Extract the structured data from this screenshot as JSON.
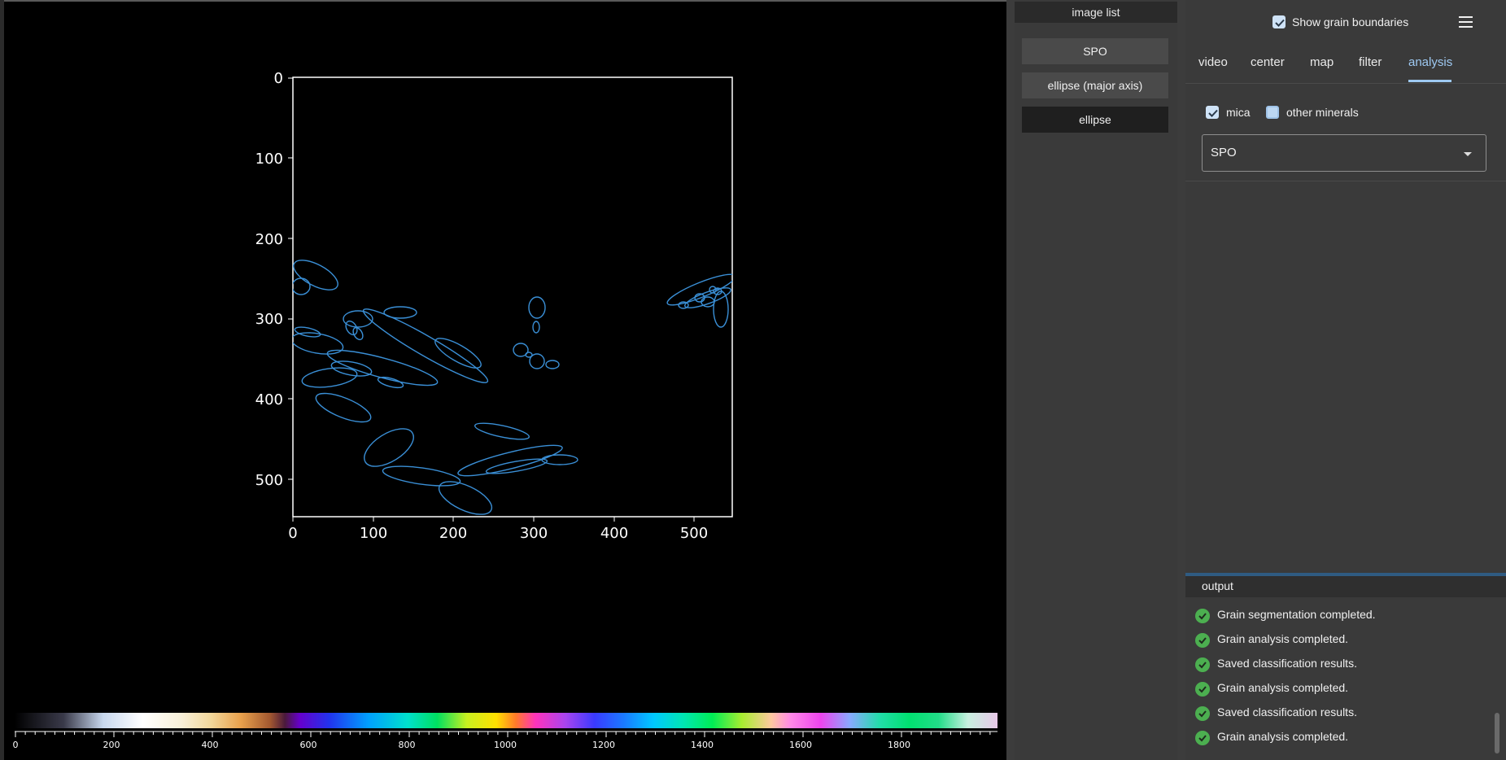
{
  "viewer": {
    "plot": {
      "xticks": [
        "0",
        "100",
        "200",
        "300",
        "400",
        "500"
      ],
      "yticks": [
        "0",
        "100",
        "200",
        "300",
        "400",
        "500"
      ],
      "grain_color": "#3a8fd6"
    },
    "colorbar": {
      "labels": [
        "0",
        "200",
        "400",
        "600",
        "800",
        "1000",
        "1200",
        "1400",
        "1600",
        "1800"
      ]
    }
  },
  "image_list": {
    "header": "image list",
    "items": [
      {
        "label": "SPO",
        "selected": false
      },
      {
        "label": "ellipse (major axis)",
        "selected": false
      },
      {
        "label": "ellipse",
        "selected": true
      }
    ]
  },
  "panel": {
    "show_grain_boundaries": {
      "label": "Show grain boundaries",
      "checked": true
    },
    "menu_icon": "hamburger-menu-icon",
    "tabs": [
      {
        "label": "video",
        "active": false
      },
      {
        "label": "center",
        "active": false
      },
      {
        "label": "map",
        "active": false
      },
      {
        "label": "filter",
        "active": false
      },
      {
        "label": "analysis",
        "active": true
      }
    ],
    "filters": {
      "mica": {
        "label": "mica",
        "checked": true
      },
      "other": {
        "label": "other minerals",
        "checked": false
      }
    },
    "method_select": {
      "value": "SPO"
    },
    "output": {
      "header": "output",
      "messages": [
        "Grain segmentation completed.",
        "Grain analysis completed.",
        "Saved classification results.",
        "Grain analysis completed.",
        "Saved classification results.",
        "Grain analysis completed."
      ]
    },
    "accent_color": "#9ec9f2",
    "success_color": "#4caf50"
  }
}
